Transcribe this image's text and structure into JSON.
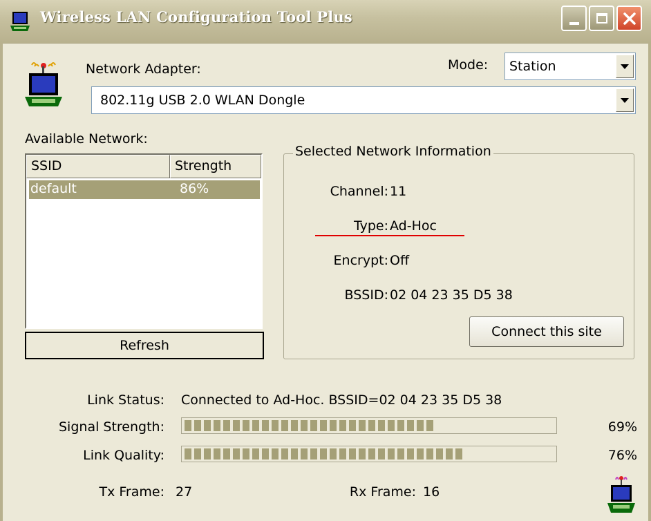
{
  "window": {
    "title": "Wireless LAN Configuration Tool Plus"
  },
  "adapter": {
    "label": "Network Adapter:",
    "value": "802.11g USB 2.0 WLAN Dongle"
  },
  "mode": {
    "label": "Mode:",
    "value": "Station"
  },
  "available": {
    "label": "Available Network:",
    "columns": [
      "SSID",
      "Strength"
    ],
    "rows": [
      {
        "ssid": "default",
        "strength": "86%"
      }
    ],
    "refresh_label": "Refresh"
  },
  "selected": {
    "title": "Selected Network Information",
    "channel_label": "Channel:",
    "channel": "11",
    "type_label": "Type:",
    "type": "Ad-Hoc",
    "encrypt_label": "Encrypt:",
    "encrypt": "Off",
    "bssid_label": "BSSID:",
    "bssid": "02 04 23 35 D5 38",
    "connect_label": "Connect this site"
  },
  "status": {
    "link_label": "Link Status:",
    "link_value": "Connected to Ad-Hoc. BSSID=02 04 23 35 D5 38",
    "signal_label": "Signal Strength:",
    "signal_text": "69%",
    "signal_value": 0.69,
    "quality_label": "Link Quality:",
    "quality_text": "76%",
    "quality_value": 0.76,
    "tx_label": "Tx Frame:",
    "tx": "27",
    "rx_label": "Rx Frame:",
    "rx": "16"
  },
  "colors": {
    "selection": "#a5a077",
    "bar_fill": "#a5a077",
    "underline": "#e00000"
  },
  "icons": {
    "app": "laptop-antenna-icon",
    "adapter": "laptop-antenna-icon",
    "status": "laptop-antenna-icon"
  }
}
